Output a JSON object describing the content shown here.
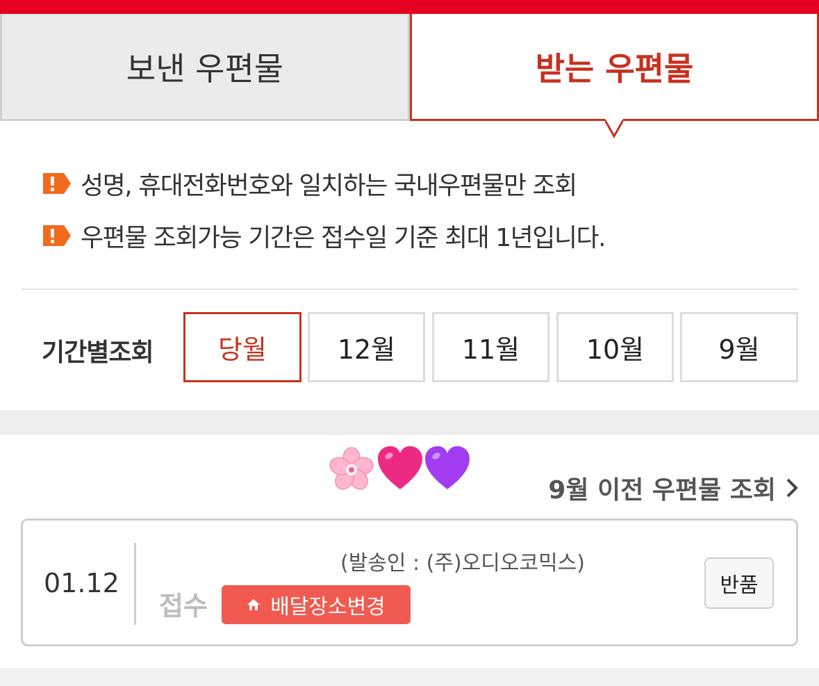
{
  "tabs": {
    "sent_label": "보낸 우편물",
    "received_label": "받는 우편물"
  },
  "notices": [
    "성명, 휴대전화번호와 일치하는 국내우편물만 조회",
    "우편물 조회가능 기간은 접수일 기준 최대 1년입니다."
  ],
  "period": {
    "label": "기간별조회",
    "options": [
      "당월",
      "12월",
      "11월",
      "10월",
      "9월"
    ],
    "selected": "당월"
  },
  "emoji": [
    "cherry-blossom",
    "pink-heart",
    "purple-heart"
  ],
  "earlier_link": "9월 이전 우편물 조회",
  "item": {
    "date": "01.12",
    "sender": "(발송인 : (주)오디오코믹스)",
    "status": "접수",
    "change_delivery_label": "배달장소변경",
    "return_label": "반품"
  },
  "colors": {
    "brand_red": "#e50021",
    "accent_red": "#c8301e",
    "button_red": "#f05a50",
    "warn_orange": "#f26a1b"
  }
}
